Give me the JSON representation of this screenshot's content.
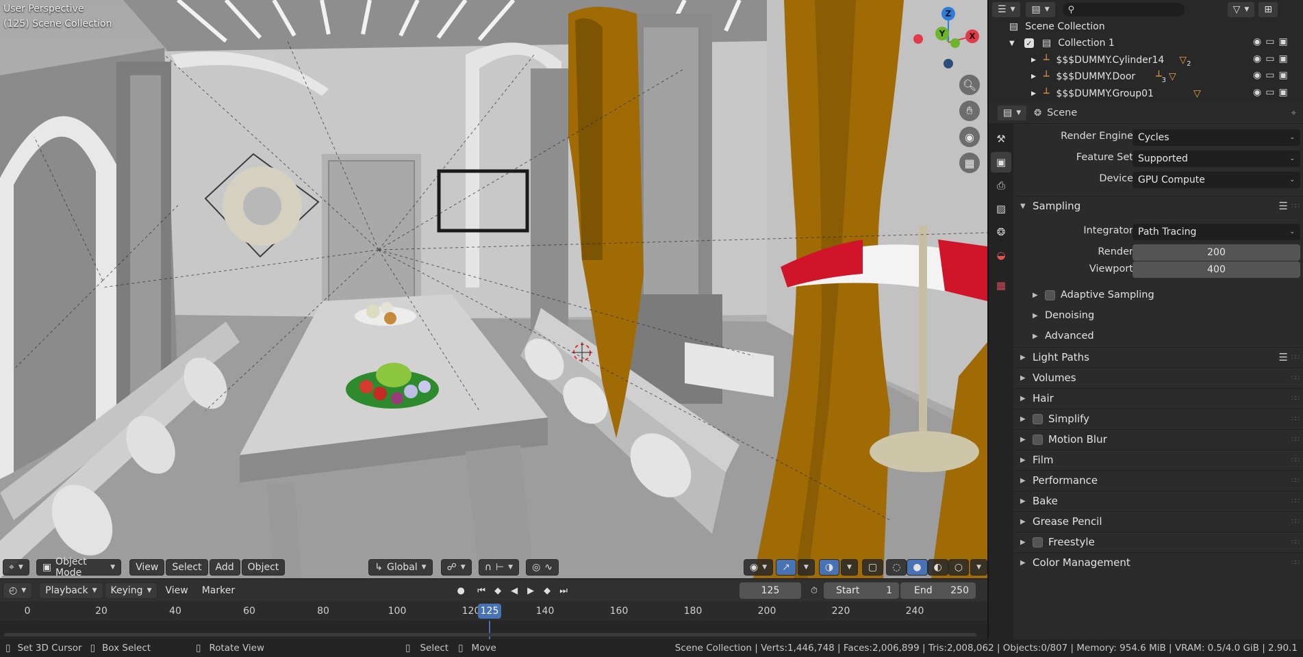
{
  "viewport": {
    "title": "User Perspective",
    "subtitle": "(125) Scene Collection",
    "gizmo": {
      "z": "Z",
      "y": "Y",
      "x": "X"
    },
    "tools": [
      "zoom-icon",
      "hand-icon",
      "camera-icon",
      "grid-icon"
    ],
    "header": {
      "mode": "Object Mode",
      "menus": [
        "View",
        "Select",
        "Add",
        "Object"
      ],
      "orientation": "Global"
    }
  },
  "timeline": {
    "menus": [
      "Playback",
      "Keying",
      "View",
      "Marker"
    ],
    "current_frame": "125",
    "start_label": "Start",
    "start_value": "1",
    "end_label": "End",
    "end_value": "250",
    "ticks": [
      "0",
      "20",
      "40",
      "60",
      "80",
      "100",
      "120",
      "140",
      "160",
      "180",
      "200",
      "220",
      "240"
    ],
    "tick_frames": [
      0,
      20,
      40,
      60,
      80,
      100,
      120,
      140,
      160,
      180,
      200,
      220,
      240
    ],
    "playhead_label": "125",
    "playhead_frame": 125
  },
  "statusbar": {
    "set_cursor": "Set 3D Cursor",
    "box_select": "Box Select",
    "rotate_view": "Rotate View",
    "select": "Select",
    "move": "Move",
    "stats": "Scene Collection | Verts:1,446,748 | Faces:2,006,899 | Tris:2,008,062 | Objects:0/807 | Memory: 954.6 MiB | VRAM: 0.5/4.0 GiB | 2.90.1"
  },
  "outliner": {
    "root": "Scene Collection",
    "collection": "Collection 1",
    "items": [
      {
        "name": "$$$DUMMY.Cylinder14",
        "badge": "2"
      },
      {
        "name": "$$$DUMMY.Door",
        "badge": "3"
      },
      {
        "name": "$$$DUMMY.Group01",
        "badge": ""
      }
    ]
  },
  "properties": {
    "context": "Scene",
    "render_engine_label": "Render Engine",
    "render_engine": "Cycles",
    "feature_set_label": "Feature Set",
    "feature_set": "Supported",
    "device_label": "Device",
    "device": "GPU Compute",
    "sampling": {
      "title": "Sampling",
      "integrator_label": "Integrator",
      "integrator": "Path Tracing",
      "render_label": "Render",
      "render": "200",
      "viewport_label": "Viewport",
      "viewport": "400",
      "subpanels": [
        "Adaptive Sampling",
        "Denoising",
        "Advanced"
      ]
    },
    "panels": [
      "Light Paths",
      "Volumes",
      "Hair",
      "Simplify",
      "Motion Blur",
      "Film",
      "Performance",
      "Bake",
      "Grease Pencil",
      "Freestyle",
      "Color Management"
    ]
  },
  "colors": {
    "accent": "#4772b3",
    "curtain": "#a06a05",
    "umbrella_red": "#d0152a",
    "gizmo_x": "#e13a4a",
    "gizmo_y": "#6fb52a",
    "gizmo_z": "#2f7dd9"
  }
}
